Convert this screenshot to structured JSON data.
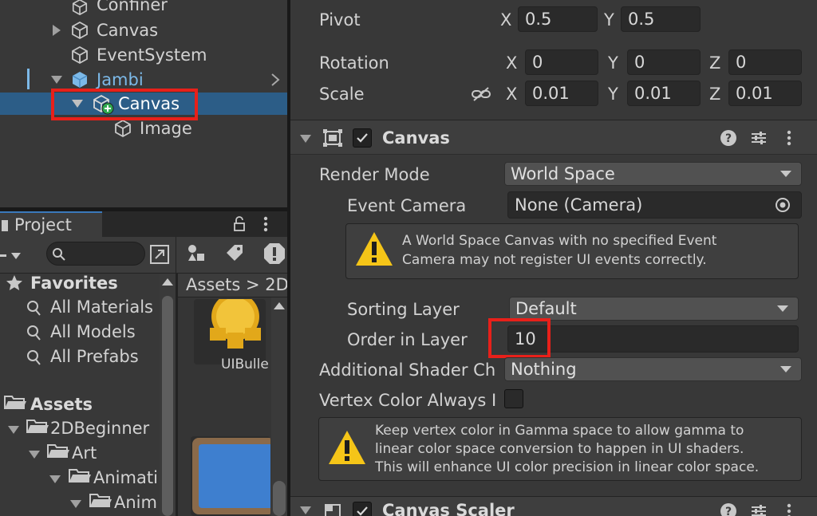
{
  "hierarchy": {
    "items": [
      {
        "label": "Confiner"
      },
      {
        "label": "Canvas"
      },
      {
        "label": "EventSystem"
      },
      {
        "label": "Jambi"
      },
      {
        "label": "Canvas"
      },
      {
        "label": "Image"
      }
    ]
  },
  "project": {
    "tab_label": "Project",
    "breadcrumb": "Assets > 2D",
    "favorites_label": "Favorites",
    "favorites": [
      "All Materials",
      "All Models",
      "All Prefabs"
    ],
    "assets_label": "Assets",
    "folders": [
      "2DBeginner",
      "Art",
      "Animati",
      "Anim"
    ],
    "asset_name": "UIBulle"
  },
  "inspector": {
    "transform": {
      "pivot_label": "Pivot",
      "pivot_x": "0.5",
      "pivot_y": "0.5",
      "rotation_label": "Rotation",
      "rotation": {
        "x": "0",
        "y": "0",
        "z": "0"
      },
      "scale_label": "Scale",
      "scale": {
        "x": "0.01",
        "y": "0.01",
        "z": "0.01"
      },
      "axis_x": "X",
      "axis_y": "Y",
      "axis_z": "Z"
    },
    "canvas": {
      "title": "Canvas",
      "render_mode_label": "Render Mode",
      "render_mode_value": "World Space",
      "event_camera_label": "Event Camera",
      "event_camera_value": "None (Camera)",
      "warning_text_1": "A World Space Canvas with no specified Event",
      "warning_text_2": "Camera may not register UI events correctly.",
      "sorting_layer_label": "Sorting Layer",
      "sorting_layer_value": "Default",
      "order_in_layer_label": "Order in Layer",
      "order_in_layer_value": "10",
      "additional_shader_label": "Additional Shader Ch",
      "additional_shader_value": "Nothing",
      "vertex_color_label": "Vertex Color Always I",
      "info_text_1": "Keep vertex color in Gamma space to allow gamma to",
      "info_text_2": "linear color space conversion to happen in UI shaders.",
      "info_text_3": "This will enhance UI color precision in linear color space."
    },
    "canvas_scaler": {
      "title": "Canvas Scaler"
    }
  },
  "colors": {
    "highlight_box": "#e8201a",
    "selection": "#2c5d87",
    "prefab_blue": "#7cb9e8",
    "warning_yellow": "#f5c518"
  }
}
